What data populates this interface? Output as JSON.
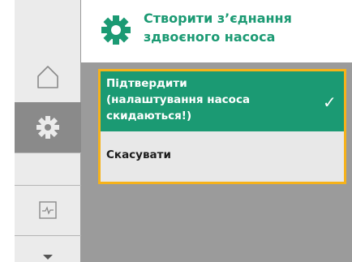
{
  "header": {
    "icon": "gear-icon",
    "title_line1": "Створити з’єднання",
    "title_line2": "здвоєного насоса"
  },
  "sidebar": {
    "items": [
      {
        "icon": "home-icon",
        "active": false
      },
      {
        "icon": "gear-icon",
        "active": true
      },
      {
        "icon": "diagnostics-icon",
        "active": false
      }
    ],
    "scroll_indicator": "chevron-down-icon"
  },
  "dialog": {
    "confirm_line1": "Підтвердити",
    "confirm_line2": "(налаштування насоса",
    "confirm_line3": "скидаються!)",
    "confirm_check": "✓",
    "cancel_label": "Скасувати"
  },
  "colors": {
    "accent": "#1b9a73",
    "focus_border": "#f6b21a",
    "rail_active": "#8a8a8a",
    "rail_bg": "#ebebeb",
    "content_bg": "#9b9b9b"
  }
}
